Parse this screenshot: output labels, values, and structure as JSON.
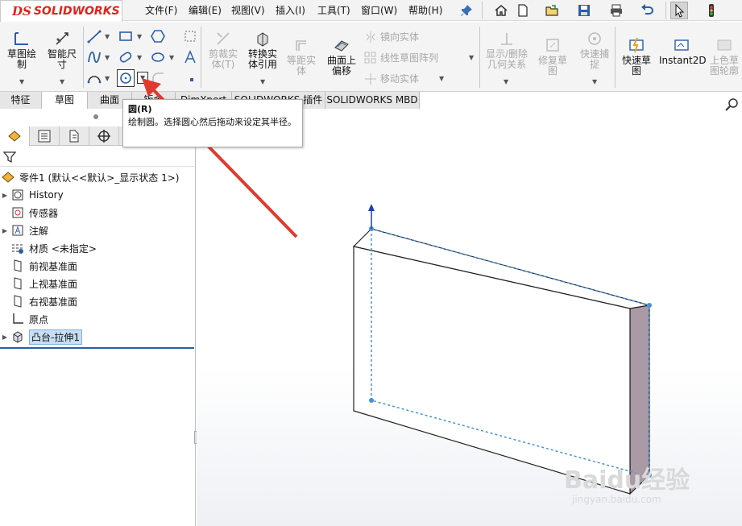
{
  "brand": {
    "ds_mark": "DS",
    "name": "SOLIDWORKS"
  },
  "menubar": {
    "items": [
      "文件(F)",
      "编辑(E)",
      "视图(V)",
      "插入(I)",
      "工具(T)",
      "窗口(W)",
      "帮助(H)"
    ]
  },
  "quick_access": [
    "home-icon",
    "new-file-icon",
    "open-file-icon",
    "save-icon",
    "print-icon",
    "undo-icon",
    "select-cursor-icon",
    "traffic-light-icon"
  ],
  "ribbon": {
    "sketch_label": "草图绘\n制",
    "smart_dim_label": "智能尺\n寸",
    "trim_label": "剪裁实\n体(T)",
    "convert_label": "转换实\n体引用",
    "offset_label": "等距实\n体",
    "surface_offset_label": "曲面上\n偏移",
    "mirror_label": "镜向实体",
    "linear_pattern_label": "线性草图阵列",
    "move_label": "移动实体",
    "show_relations_label": "显示/删除\n几何关系",
    "repair_label": "修复草\n图",
    "quick_snap_label": "快速捕\n捉",
    "rapid_sketch_label": "快速草\n图",
    "instant2d_label": "Instant2D",
    "shaded_sketch_label": "上色草\n图轮廓"
  },
  "tabs": [
    "特征",
    "草图",
    "曲面",
    "钣金",
    "DimXpert",
    "SOLIDWORKS 插件",
    "SOLIDWORKS MBD"
  ],
  "active_tab": "草图",
  "tooltip": {
    "title": "圆(R)",
    "body": "绘制圆。选择圆心然后拖动来设定其半径。"
  },
  "tree": {
    "root": "零件1 (默认<<默认>_显示状态 1>)",
    "items": [
      "History",
      "传感器",
      "注解",
      "材质 <未指定>",
      "前视基准面",
      "上视基准面",
      "右视基准面",
      "原点",
      "凸台-拉伸1"
    ]
  },
  "watermark": {
    "brand": "Baidu经验",
    "url": "jingyan.baidu.com"
  },
  "colors": {
    "brand_red": "#e0231a",
    "selection_blue": "#c7def5",
    "sketch_blue": "#4a90d9",
    "arrow_red": "#e03a2f",
    "side_face": "#a99aa6"
  }
}
